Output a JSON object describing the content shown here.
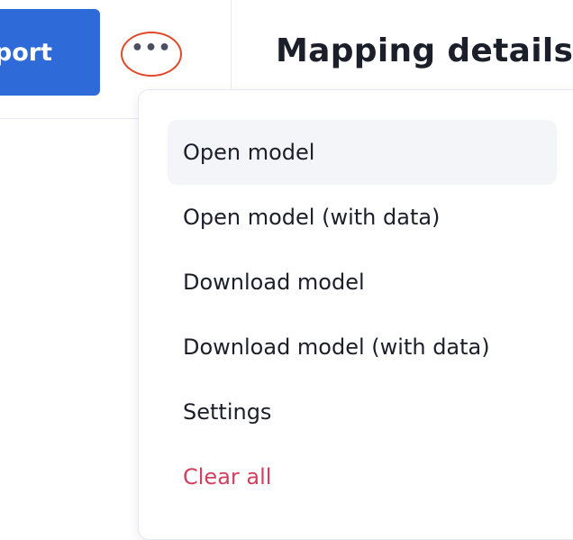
{
  "toolbar": {
    "export_label": "Export",
    "more_label": "•••"
  },
  "panel": {
    "title": "Mapping details"
  },
  "menu": {
    "items": [
      {
        "label": "Open model",
        "state": "hover"
      },
      {
        "label": "Open model (with data)"
      },
      {
        "label": "Download model"
      },
      {
        "label": "Download model (with data)"
      },
      {
        "label": "Settings"
      },
      {
        "label": "Clear all",
        "color": "#d2405f"
      }
    ]
  },
  "colors": {
    "primary_button": "#2e6ad8",
    "highlight_ring": "#df4a2b",
    "danger_text": "#d2405f",
    "hover_background": "#f4f5f8"
  }
}
